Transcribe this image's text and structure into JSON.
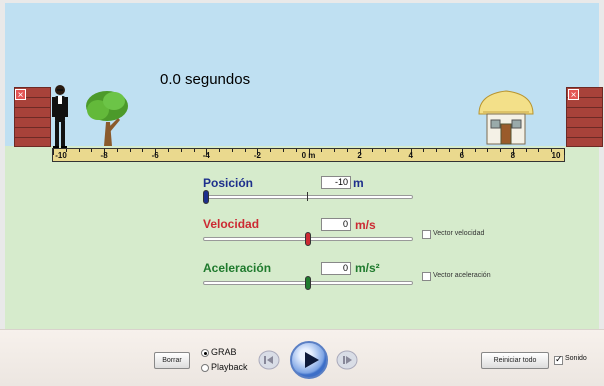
{
  "timer": {
    "text": "0.0 segundos"
  },
  "walls": {
    "close_symbol": "×"
  },
  "ruler": {
    "labels": [
      "-10",
      "-8",
      "-6",
      "-4",
      "-2",
      "0 m",
      "2",
      "4",
      "6",
      "8",
      "10"
    ]
  },
  "sliders": {
    "position": {
      "label": "Posición",
      "value": "-10",
      "unit": "m",
      "level_fraction": 0.0,
      "color": "#1d2f8c"
    },
    "velocity": {
      "label": "Velocidad",
      "value": "0",
      "unit": "m/s",
      "level_fraction": 0.5,
      "color": "#cc2a33",
      "checkbox_label": "Vector velocidad",
      "checkbox_checked": false
    },
    "acceleration": {
      "label": "Aceleración",
      "value": "0",
      "unit": "m/s²",
      "level_fraction": 0.5,
      "color": "#1f7a2d",
      "checkbox_label": "Vector aceleración",
      "checkbox_checked": false
    }
  },
  "controls": {
    "clear_label": "Borrar",
    "grab_label": "GRAB",
    "playback_label": "Playback",
    "selected_mode": "GRAB",
    "reset_label": "Reiniciar todo",
    "sound_label": "Sonido",
    "sound_checked": true,
    "icons": [
      "rewind-icon",
      "play-icon",
      "step-forward-icon"
    ]
  }
}
